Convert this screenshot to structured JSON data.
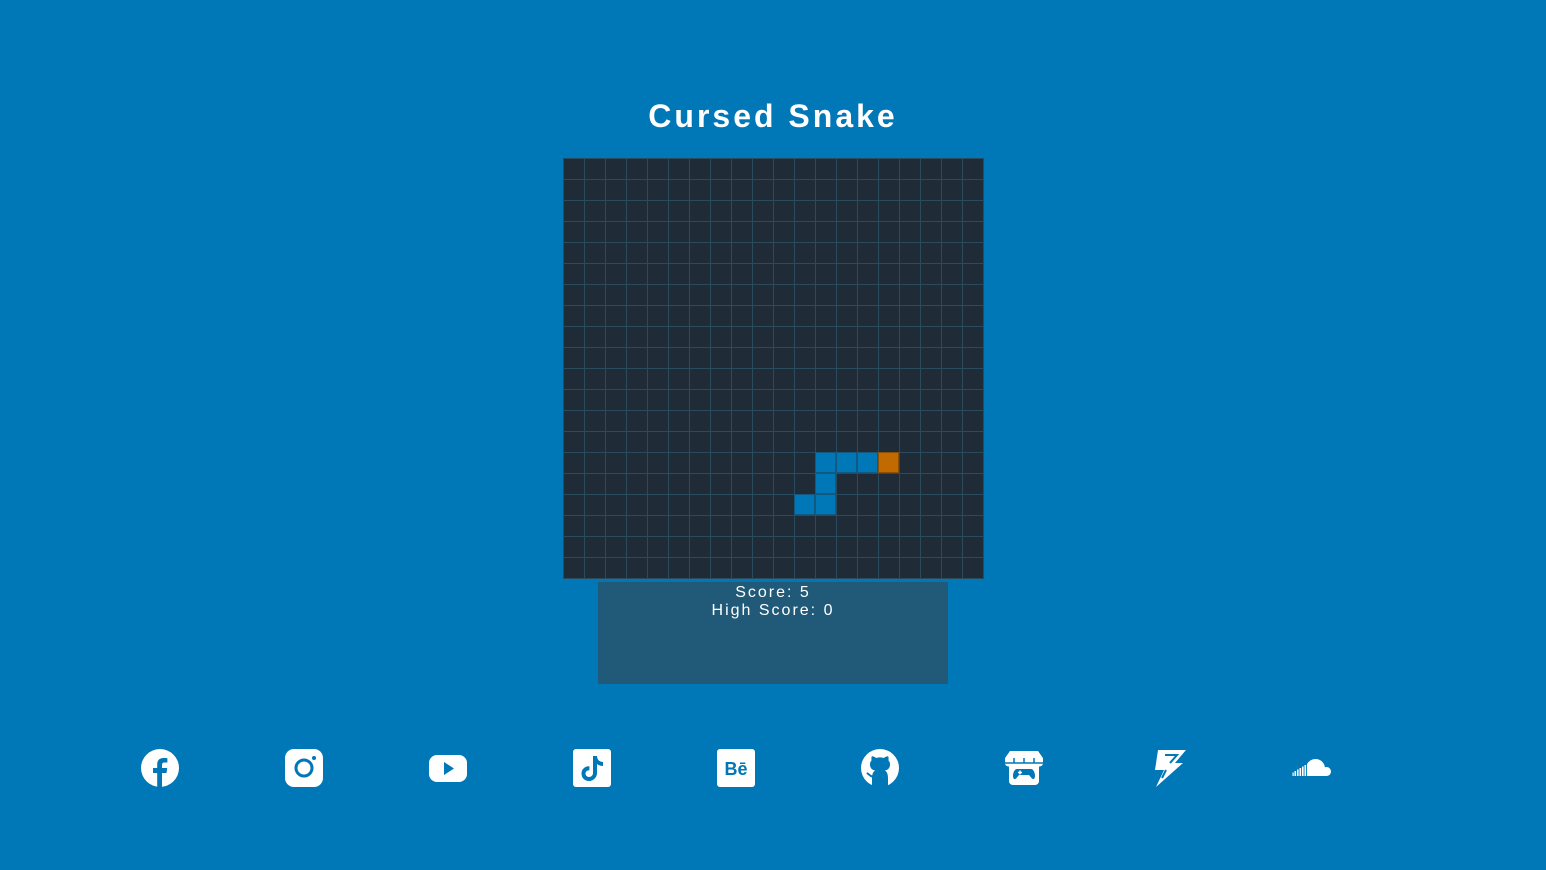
{
  "page": {
    "title": "Cursed Snake"
  },
  "game": {
    "grid": {
      "cols": 20,
      "rows": 20
    },
    "snake": [
      {
        "col": 12,
        "row": 14
      },
      {
        "col": 13,
        "row": 14
      },
      {
        "col": 14,
        "row": 14
      },
      {
        "col": 12,
        "row": 15
      },
      {
        "col": 11,
        "row": 16
      },
      {
        "col": 12,
        "row": 16
      }
    ],
    "food": {
      "col": 15,
      "row": 14
    },
    "colors": {
      "board": "#1f2b36",
      "snake": "#0077b6",
      "food": "#c16a00"
    }
  },
  "scoreboard": {
    "score_text": "Score: 5",
    "high_score_text": "High Score: 0"
  },
  "social": [
    {
      "name": "facebook-icon"
    },
    {
      "name": "instagram-icon"
    },
    {
      "name": "youtube-icon"
    },
    {
      "name": "tiktok-icon"
    },
    {
      "name": "behance-icon",
      "text": "Bē"
    },
    {
      "name": "github-icon"
    },
    {
      "name": "itchio-icon"
    },
    {
      "name": "lightning-icon"
    },
    {
      "name": "soundcloud-icon"
    }
  ]
}
